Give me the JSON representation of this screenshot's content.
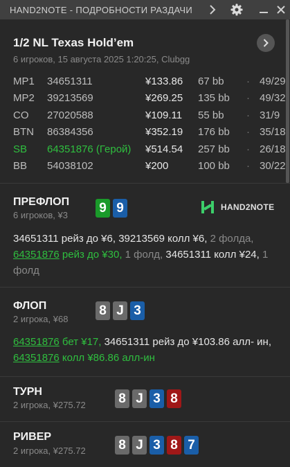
{
  "titlebar": {
    "title": "HAND2NOTE - ПОДРОБНОСТИ РАЗДАЧИ"
  },
  "game": {
    "title": "1/2 NL Texas Hold’em",
    "subtitle": "6 игроков, 15 августа 2025 1:20:25, Clubgg"
  },
  "players": [
    {
      "pos": "MP1",
      "id": "34651311",
      "stack": "¥133.86",
      "bb": "67 bb",
      "dot": "·",
      "stat": "49/29",
      "hero": false
    },
    {
      "pos": "MP2",
      "id": "39213569",
      "stack": "¥269.25",
      "bb": "135 bb",
      "dot": "·",
      "stat": "49/32",
      "hero": false
    },
    {
      "pos": "CO",
      "id": "27020588",
      "stack": "¥109.11",
      "bb": "55 bb",
      "dot": "·",
      "stat": "31/9",
      "hero": false
    },
    {
      "pos": "BTN",
      "id": "86384356",
      "stack": "¥352.19",
      "bb": "176 bb",
      "dot": "·",
      "stat": "35/18",
      "hero": false
    },
    {
      "pos": "SB",
      "id": "64351876 (Герой)",
      "stack": "¥514.54",
      "bb": "257 bb",
      "dot": "·",
      "stat": "26/18",
      "hero": true
    },
    {
      "pos": "BB",
      "id": "54038102",
      "stack": "¥200",
      "bb": "100 bb",
      "dot": "·",
      "stat": "30/22",
      "hero": false
    }
  ],
  "logo": {
    "text": "HAND2NOTE"
  },
  "streets": {
    "preflop": {
      "title": "ПРЕФЛОП",
      "sub": "6 игроков, ¥3",
      "cards": [
        {
          "rank": "9",
          "suit": "green"
        },
        {
          "rank": "9",
          "suit": "blue"
        }
      ],
      "a1": "34651311",
      "a2": "рейз до ¥6,",
      "a3": "39213569",
      "a4": "колл ¥6,",
      "a5": "2 фолда,",
      "a6": "64351876",
      "a7": "рейз до ¥30,",
      "a8": "1 фолд,",
      "a9": "34651311",
      "a10": "колл",
      "a11": "¥24,",
      "a12": "1 фолд"
    },
    "flop": {
      "title": "ФЛОП",
      "sub": "2 игрока, ¥68",
      "cards": [
        {
          "rank": "8",
          "suit": "gray"
        },
        {
          "rank": "J",
          "suit": "gray"
        },
        {
          "rank": "3",
          "suit": "blue"
        }
      ],
      "a1": "64351876",
      "a2": "бет ¥17,",
      "a3": "34651311",
      "a4": "рейз до ¥103.86 алл-",
      "a5": "ин,",
      "a6": "64351876",
      "a7": "колл ¥86.86 алл-ин"
    },
    "turn": {
      "title": "ТУРН",
      "sub": "2 игрока, ¥275.72",
      "cards": [
        {
          "rank": "8",
          "suit": "gray"
        },
        {
          "rank": "J",
          "suit": "gray"
        },
        {
          "rank": "3",
          "suit": "blue"
        },
        {
          "rank": "8",
          "suit": "red"
        }
      ]
    },
    "river": {
      "title": "РИВЕР",
      "sub": "2 игрока, ¥275.72",
      "cards": [
        {
          "rank": "8",
          "suit": "gray"
        },
        {
          "rank": "J",
          "suit": "gray"
        },
        {
          "rank": "3",
          "suit": "blue"
        },
        {
          "rank": "8",
          "suit": "red"
        },
        {
          "rank": "7",
          "suit": "blue"
        }
      ]
    }
  },
  "colors": {
    "hero_green": "#2fbf3f",
    "suit_green": "#1a9a2a",
    "suit_blue": "#1a5ea8",
    "suit_gray": "#6a6a6a",
    "suit_red": "#a01818"
  }
}
